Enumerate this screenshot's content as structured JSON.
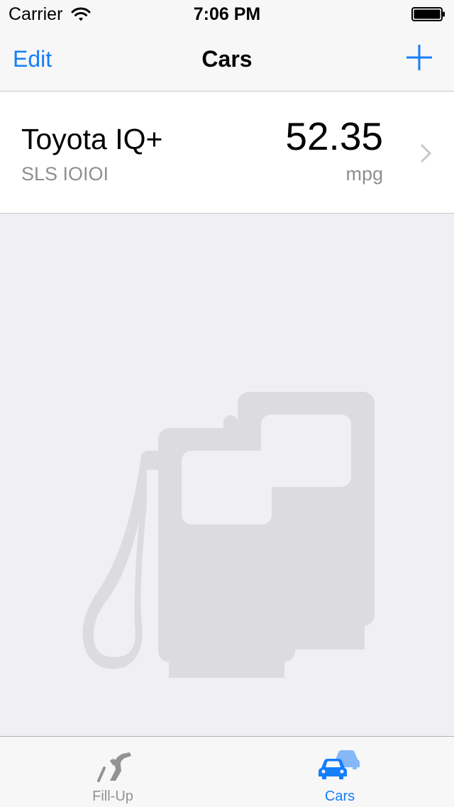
{
  "status_bar": {
    "carrier": "Carrier",
    "time": "7:06 PM"
  },
  "nav": {
    "edit_label": "Edit",
    "title": "Cars",
    "add_icon": "plus-icon"
  },
  "cars": [
    {
      "name": "Toyota IQ+",
      "plate": "SLS IOIOI",
      "mpg_value": "52.35",
      "mpg_unit": "mpg"
    }
  ],
  "tab_bar": {
    "tabs": [
      {
        "label": "Fill-Up",
        "icon": "fuel-nozzle-icon",
        "selected": false
      },
      {
        "label": "Cars",
        "icon": "cars-icon",
        "selected": true
      }
    ]
  },
  "colors": {
    "accent": "#147efb",
    "background": "#efeff4",
    "secondary_text": "#8e8e93",
    "illustration": "#dcdce0"
  }
}
